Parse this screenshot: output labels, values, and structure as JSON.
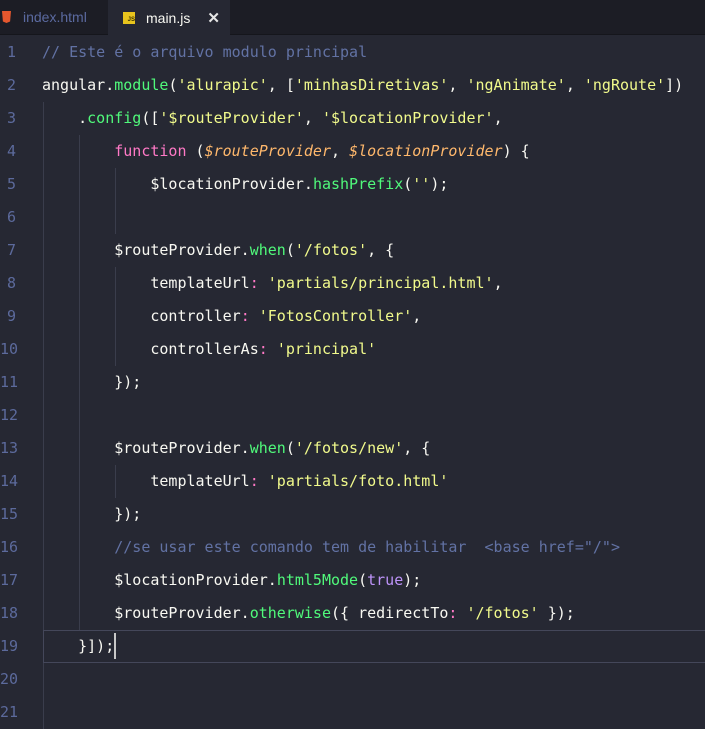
{
  "tabs": [
    {
      "label": "index.html",
      "icon": "html5-icon"
    },
    {
      "label": "main.js",
      "icon": "js-file-icon",
      "active": true,
      "close": "✕"
    }
  ],
  "colors": {
    "background": "#262833",
    "comment": "#6272a4",
    "function": "#50fa7b",
    "string": "#f1fa8c",
    "keyword": "#ff79c6",
    "param": "#ffb86c",
    "constant": "#bd93f9"
  },
  "current_line": 19,
  "lines": [
    {
      "n": "1",
      "tokens": [
        [
          "comment",
          "// Este é o arquivo modulo principal"
        ]
      ]
    },
    {
      "n": "2",
      "tokens": [
        [
          "plain",
          "angular."
        ],
        [
          "fn",
          "module"
        ],
        [
          "plain",
          "("
        ],
        [
          "str",
          "'alurapic'"
        ],
        [
          "plain",
          ", ["
        ],
        [
          "str",
          "'minhasDiretivas'"
        ],
        [
          "plain",
          ", "
        ],
        [
          "str",
          "'ngAnimate'"
        ],
        [
          "plain",
          ", "
        ],
        [
          "str",
          "'ngRoute'"
        ],
        [
          "plain",
          "])"
        ]
      ]
    },
    {
      "n": "3",
      "tokens": [
        [
          "plain",
          "    ."
        ],
        [
          "fn",
          "config"
        ],
        [
          "plain",
          "(["
        ],
        [
          "str",
          "'$routeProvider'"
        ],
        [
          "plain",
          ", "
        ],
        [
          "str",
          "'$locationProvider'"
        ],
        [
          "plain",
          ","
        ]
      ]
    },
    {
      "n": "4",
      "tokens": [
        [
          "plain",
          "        "
        ],
        [
          "kw",
          "function"
        ],
        [
          "plain",
          " ("
        ],
        [
          "param",
          "$routeProvider"
        ],
        [
          "plain",
          ", "
        ],
        [
          "param",
          "$locationProvider"
        ],
        [
          "plain",
          ") {"
        ]
      ]
    },
    {
      "n": "5",
      "tokens": [
        [
          "plain",
          "            $locationProvider."
        ],
        [
          "fn",
          "hashPrefix"
        ],
        [
          "plain",
          "("
        ],
        [
          "str",
          "''"
        ],
        [
          "plain",
          ");"
        ]
      ]
    },
    {
      "n": "6",
      "tokens": [
        [
          "plain",
          "            "
        ]
      ]
    },
    {
      "n": "7",
      "tokens": [
        [
          "plain",
          "        $routeProvider."
        ],
        [
          "fn",
          "when"
        ],
        [
          "plain",
          "("
        ],
        [
          "str",
          "'/fotos'"
        ],
        [
          "plain",
          ", {"
        ]
      ]
    },
    {
      "n": "8",
      "tokens": [
        [
          "plain",
          "            templateUrl"
        ],
        [
          "punct",
          ":"
        ],
        [
          "plain",
          " "
        ],
        [
          "str",
          "'partials/principal.html'"
        ],
        [
          "plain",
          ","
        ]
      ]
    },
    {
      "n": "9",
      "tokens": [
        [
          "plain",
          "            controller"
        ],
        [
          "punct",
          ":"
        ],
        [
          "plain",
          " "
        ],
        [
          "str",
          "'FotosController'"
        ],
        [
          "plain",
          ","
        ]
      ]
    },
    {
      "n": "10",
      "tokens": [
        [
          "plain",
          "            controllerAs"
        ],
        [
          "punct",
          ":"
        ],
        [
          "plain",
          " "
        ],
        [
          "str",
          "'principal'"
        ]
      ]
    },
    {
      "n": "11",
      "tokens": [
        [
          "plain",
          "        });"
        ]
      ]
    },
    {
      "n": "12",
      "tokens": [
        [
          "plain",
          "        "
        ]
      ]
    },
    {
      "n": "13",
      "tokens": [
        [
          "plain",
          "        $routeProvider."
        ],
        [
          "fn",
          "when"
        ],
        [
          "plain",
          "("
        ],
        [
          "str",
          "'/fotos/new'"
        ],
        [
          "plain",
          ", {"
        ]
      ]
    },
    {
      "n": "14",
      "tokens": [
        [
          "plain",
          "            templateUrl"
        ],
        [
          "punct",
          ":"
        ],
        [
          "plain",
          " "
        ],
        [
          "str",
          "'partials/foto.html'"
        ]
      ]
    },
    {
      "n": "15",
      "tokens": [
        [
          "plain",
          "        });"
        ]
      ]
    },
    {
      "n": "16",
      "tokens": [
        [
          "plain",
          "        "
        ],
        [
          "comment",
          "//se usar este comando tem de habilitar  <base href=\"/\">"
        ]
      ]
    },
    {
      "n": "17",
      "tokens": [
        [
          "plain",
          "        $locationProvider."
        ],
        [
          "fn",
          "html5Mode"
        ],
        [
          "plain",
          "("
        ],
        [
          "const",
          "true"
        ],
        [
          "plain",
          ");"
        ]
      ]
    },
    {
      "n": "18",
      "tokens": [
        [
          "plain",
          "        $routeProvider."
        ],
        [
          "fn",
          "otherwise"
        ],
        [
          "plain",
          "({ redirectTo"
        ],
        [
          "punct",
          ":"
        ],
        [
          "plain",
          " "
        ],
        [
          "str",
          "'/fotos'"
        ],
        [
          "plain",
          " });"
        ]
      ]
    },
    {
      "n": "19",
      "tokens": [
        [
          "plain",
          "    }]);"
        ]
      ]
    },
    {
      "n": "20",
      "tokens": []
    },
    {
      "n": "21",
      "tokens": []
    }
  ]
}
